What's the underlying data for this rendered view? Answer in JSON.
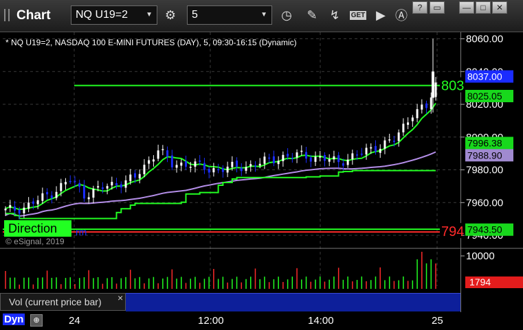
{
  "app": {
    "title": "Chart",
    "symbol_input": "NQ U19=2",
    "interval_input": "5",
    "get_button": "GET",
    "window_buttons": [
      "?",
      "▭",
      "—",
      "□",
      "✕"
    ]
  },
  "chart": {
    "description": "* NQ U19=2, NASDAQ 100 E-MINI FUTURES (DAY), 5, 09:30-16:15 (Dynamic)",
    "watermark": "© eSignal, 2019",
    "direction_label": "Direction",
    "partial_label": "rm",
    "volume_pane_label": "Vol (current price bar)",
    "close_x": "×",
    "dyn_label": "Dyn"
  },
  "chart_data": {
    "type": "candlestick",
    "price_axis": {
      "ylim": [
        7935,
        8064
      ],
      "ticks": [
        7940,
        7960,
        7980,
        8000,
        8020,
        8040,
        8060
      ],
      "tick_labels": [
        "7940.00",
        "7960.00",
        "7980.00",
        "8000.00",
        "8020.00",
        "8040.00",
        "8060.00"
      ]
    },
    "time_axis": {
      "tick_labels": [
        "24",
        "12:00",
        "14:00",
        "25"
      ]
    },
    "price_tags": [
      {
        "label": "8037.00",
        "value": 8037,
        "bg": "#1a2cff",
        "fg": "#ffffff"
      },
      {
        "label": "8025.05",
        "value": 8025.05,
        "bg": "#18d81c",
        "fg": "#000000"
      },
      {
        "label": "7996.38",
        "value": 7996.38,
        "bg": "#18d81c",
        "fg": "#000000"
      },
      {
        "label": "7988.90",
        "value": 7988.9,
        "bg": "#a08ad0",
        "fg": "#000000"
      },
      {
        "label": "7943.50",
        "value": 7943.5,
        "bg": "#18d81c",
        "fg": "#000000"
      }
    ],
    "line_labels": [
      {
        "label": "803",
        "value": 8031.5,
        "color": "#22ff22"
      },
      {
        "label": "794",
        "value": 7942.5,
        "color": "#ff2a2a"
      }
    ],
    "volume_axis": {
      "tick_labels": [
        "10000"
      ],
      "current_label": "1794",
      "current_color": "#e31c1c"
    },
    "colors": {
      "up": "#ffffff",
      "down": "#1a2cff",
      "ma_fast": "#22ff22",
      "ma_slow": "#b48ee8",
      "resistance": "#22ff22",
      "support": "#ff2a2a"
    }
  }
}
